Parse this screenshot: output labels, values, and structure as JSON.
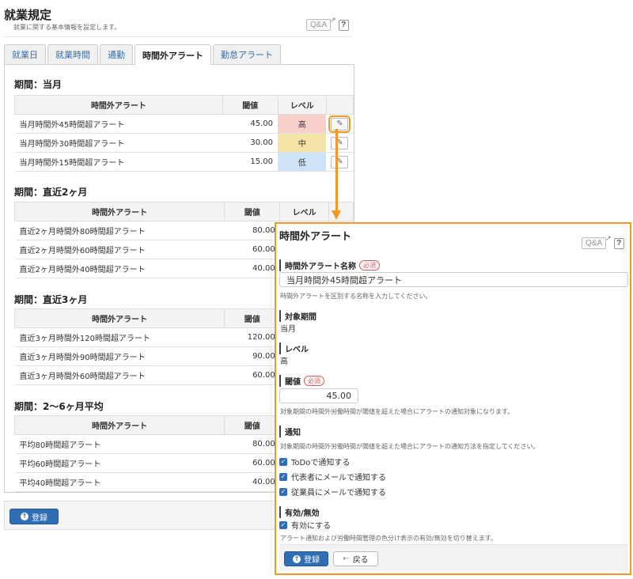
{
  "header": {
    "title": "就業規定",
    "description": "就業に関する基本情報を設定します。",
    "qa_label": "Q&A",
    "help_label": "?"
  },
  "tabs": [
    {
      "label": "就業日"
    },
    {
      "label": "就業時間"
    },
    {
      "label": "通勤"
    },
    {
      "label": "時間外アラート",
      "active": true
    },
    {
      "label": "勤怠アラート"
    }
  ],
  "table_headers": {
    "name": "時間外アラート",
    "threshold": "閾値",
    "level": "レベル"
  },
  "sections": [
    {
      "title": "期間：当月",
      "rows": [
        {
          "name": "当月時間外45時間超アラート",
          "threshold": "45.00",
          "level": "高"
        },
        {
          "name": "当月時間外30時間超アラート",
          "threshold": "30.00",
          "level": "中"
        },
        {
          "name": "当月時間外15時間超アラート",
          "threshold": "15.00",
          "level": "低"
        }
      ]
    },
    {
      "title": "期間：直近2ヶ月",
      "rows": [
        {
          "name": "直近2ヶ月時間外80時間超アラート",
          "threshold": "80.00",
          "level": ""
        },
        {
          "name": "直近2ヶ月時間外60時間超アラート",
          "threshold": "60.00",
          "level": ""
        },
        {
          "name": "直近2ヶ月時間外40時間超アラート",
          "threshold": "40.00",
          "level": ""
        }
      ]
    },
    {
      "title": "期間：直近3ヶ月",
      "rows": [
        {
          "name": "直近3ヶ月時間外120時間超アラート",
          "threshold": "120.00",
          "level": ""
        },
        {
          "name": "直近3ヶ月時間外90時間超アラート",
          "threshold": "90.00",
          "level": ""
        },
        {
          "name": "直近3ヶ月時間外60時間超アラート",
          "threshold": "60.00",
          "level": ""
        }
      ]
    },
    {
      "title": "期間：2〜6ヶ月平均",
      "rows": [
        {
          "name": "平均80時間超アラート",
          "threshold": "80.00",
          "level": ""
        },
        {
          "name": "平均60時間超アラート",
          "threshold": "60.00",
          "level": ""
        },
        {
          "name": "平均40時間超アラート",
          "threshold": "40.00",
          "level": ""
        }
      ]
    }
  ],
  "footer": {
    "register_label": "登録"
  },
  "modal": {
    "title": "時間外アラート",
    "name_label": "時間外アラート名称",
    "required": "必須",
    "name_value": "当月時間外45時間超アラート",
    "name_hint": "時間外アラートを区別する名称を入力してください。",
    "period_label": "対象期間",
    "period_value": "当月",
    "level_label": "レベル",
    "level_value": "高",
    "threshold_label": "閾値",
    "threshold_value": "45.00",
    "threshold_hint": "対象期間の時間外労働時間が閾値を超えた場合にアラートの通知対象になります。",
    "notify_label": "通知",
    "notify_hint": "対象期間の時間外労働時間が閾値を超えた場合にアラートの通知方法を指定してください。",
    "notify_options": [
      {
        "label": "ToDoで通知する",
        "checked": true
      },
      {
        "label": "代表者にメールで通知する",
        "checked": true
      },
      {
        "label": "従業員にメールで通知する",
        "checked": true
      }
    ],
    "enable_label": "有効/無効",
    "enable_option": "有効にする",
    "enable_hint": "アラート通知および労働時間管理の色分け表示の有効/無効を切り替えます。",
    "register_label": "登録",
    "back_label": "戻る"
  },
  "colors": {
    "accent": "#f29a1f",
    "primary": "#2f6eb4",
    "level_high": "#f8cfcb",
    "level_mid": "#f4e4a8",
    "level_low": "#cfe3f8"
  }
}
